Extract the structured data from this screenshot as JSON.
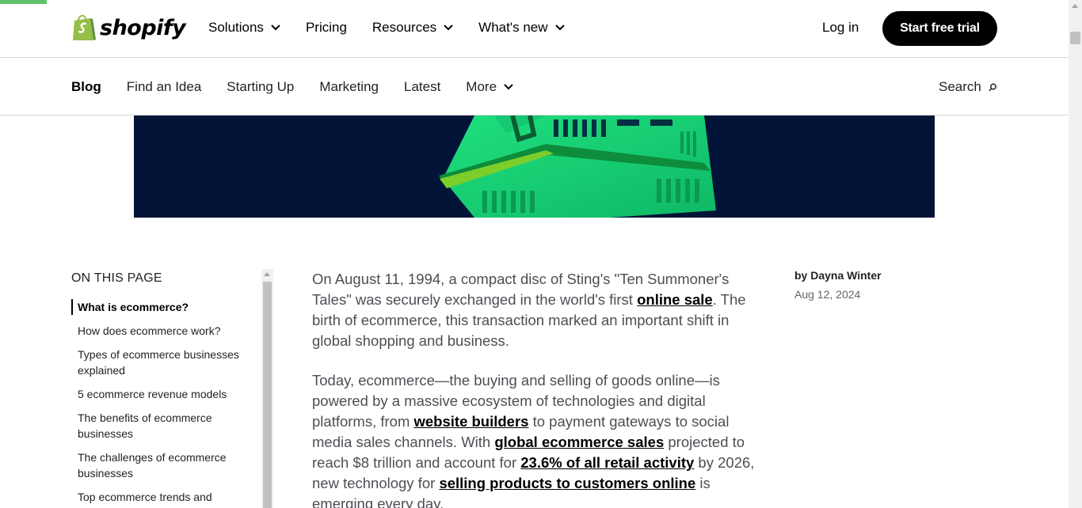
{
  "header": {
    "brand": "shopify",
    "nav": [
      {
        "label": "Solutions",
        "dropdown": true
      },
      {
        "label": "Pricing",
        "dropdown": false
      },
      {
        "label": "Resources",
        "dropdown": true
      },
      {
        "label": "What's new",
        "dropdown": true
      }
    ],
    "login": "Log in",
    "cta": "Start free trial"
  },
  "blognav": {
    "items": [
      {
        "label": "Blog"
      },
      {
        "label": "Find an Idea"
      },
      {
        "label": "Starting Up"
      },
      {
        "label": "Marketing"
      },
      {
        "label": "Latest"
      },
      {
        "label": "More"
      }
    ],
    "search": "Search"
  },
  "toc": {
    "title": "ON THIS PAGE",
    "items": [
      "What is ecommerce?",
      "How does ecommerce work?",
      "Types of ecommerce businesses explained",
      "5 ecommerce revenue models",
      "The benefits of ecommerce businesses",
      "The challenges of ecommerce businesses",
      "Top ecommerce trends and"
    ]
  },
  "article": {
    "p1": {
      "a": "On August 11, 1994, a compact disc of Sting's \"Ten Summoner's Tales\" was securely exchanged in the world's first ",
      "link1": "online sale",
      "b": ". The birth of ecommerce, this transaction marked an important shift in global shopping and business."
    },
    "p2": {
      "a": "Today, ecommerce—the buying and selling of goods online—is powered by a massive ecosystem of technologies and digital platforms, from ",
      "link1": "website builders",
      "b": " to payment gateways to social media sales channels. With ",
      "link2": "global ecommerce sales",
      "c": " projected to reach $8 trillion and account for ",
      "link3": "23.6% of all retail activity",
      "d": " by 2026, new technology for ",
      "link4": "selling products to customers online",
      "e": " is emerging every day."
    }
  },
  "author": {
    "byline": "by Dayna Winter",
    "date": "Aug 12, 2024"
  },
  "colors": {
    "accent": "#5ec26a",
    "hero_bg": "#011438",
    "cta_bg": "#000000"
  }
}
